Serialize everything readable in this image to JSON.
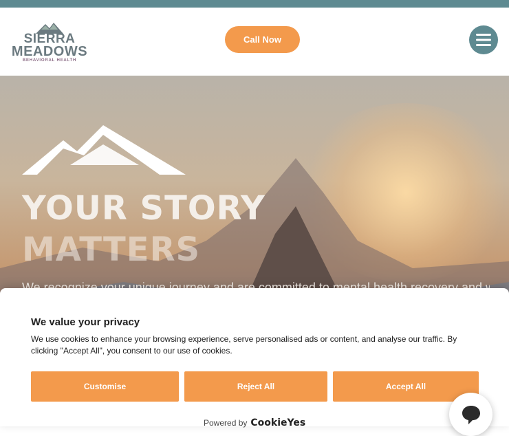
{
  "header": {
    "logo_line1": "SIERRA",
    "logo_line2": "MEADOWS",
    "logo_sub": "BEHAVIORAL HEALTH",
    "call_label": "Call Now",
    "menu_icon": "hamburger-icon"
  },
  "hero": {
    "title_line1": "YOUR STORY",
    "title_line2": "MATTERS",
    "subtitle": "We recognize your unique journey and are committed to mental health recovery and wellness"
  },
  "cookie_banner": {
    "title": "We value your privacy",
    "text": "We use cookies to enhance your browsing experience, serve personalised ads or content, and analyse our traffic. By clicking \"Accept All\", you consent to our use of cookies.",
    "customise_label": "Customise",
    "reject_label": "Reject All",
    "accept_label": "Accept All",
    "powered_label": "Powered by",
    "brand": "CookieYes"
  },
  "colors": {
    "accent": "#f39a4c",
    "brand_teal": "#5e8a91"
  }
}
